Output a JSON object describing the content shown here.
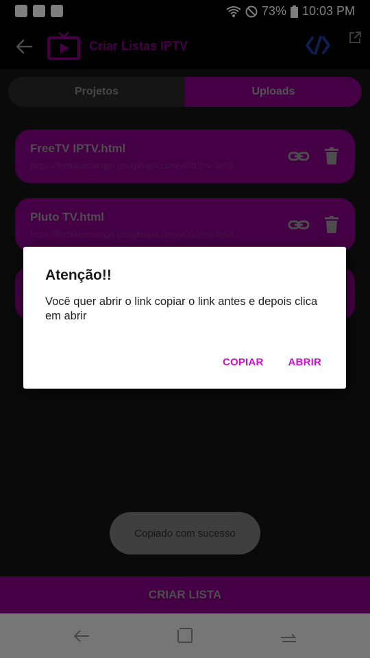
{
  "status_bar": {
    "battery": "73%",
    "time": "10:03 PM"
  },
  "app_bar": {
    "title": "Criar Listas IPTV"
  },
  "tabs": [
    {
      "label": "Projetos"
    },
    {
      "label": "Uploads"
    }
  ],
  "uploads": [
    {
      "title": "FreeTV IPTV.html",
      "url": "https://firebasestorage.googleapis.com/v0/b/iptv-3e59..."
    },
    {
      "title": "Pluto TV.html",
      "url": "https://firebasestorage.googleapis.com/v0/b/iptv-3e59..."
    },
    {
      "title": "",
      "url": ""
    }
  ],
  "toast": {
    "message": "Copiado com sucesso"
  },
  "bottom_button": {
    "label": "CRIAR LISTA"
  },
  "dialog": {
    "title": "Atenção!!",
    "message": "Você quer abrir o link copiar o link antes e depois clica em abrir",
    "copy_label": "COPIAR",
    "open_label": "ABRIR"
  },
  "colors": {
    "accent": "#8b008b",
    "dialog_button": "#d010d0",
    "background": "#151515"
  }
}
